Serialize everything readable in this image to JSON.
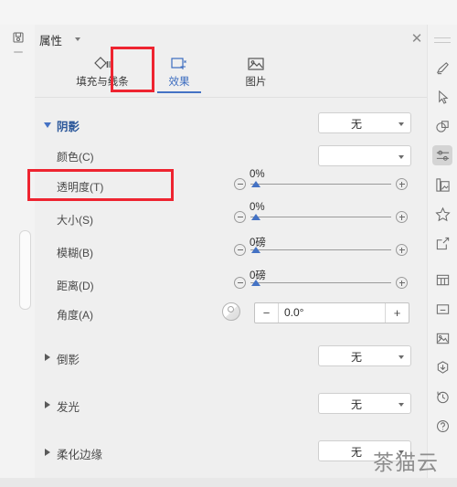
{
  "panel": {
    "title": "属性",
    "close_label": "✕",
    "pin_icon": "pin-icon"
  },
  "tabs": [
    {
      "label": "填充与线条",
      "icon": "fill-line-icon",
      "active": false
    },
    {
      "label": "效果",
      "icon": "effects-icon",
      "active": true
    },
    {
      "label": "图片",
      "icon": "picture-icon",
      "active": false
    }
  ],
  "sections": [
    {
      "name": "shadow",
      "label": "阴影",
      "expanded": true,
      "rows": [
        {
          "name": "preset",
          "label": "",
          "control": "dropdown",
          "value": "无"
        },
        {
          "name": "color",
          "label": "颜色(C)",
          "control": "dropdown",
          "value": ""
        },
        {
          "name": "transparency",
          "label": "透明度(T)",
          "control": "slider",
          "value": "0%"
        },
        {
          "name": "size",
          "label": "大小(S)",
          "control": "slider",
          "value": "0%"
        },
        {
          "name": "blur",
          "label": "模糊(B)",
          "control": "slider",
          "value": "0磅"
        },
        {
          "name": "distance",
          "label": "距离(D)",
          "control": "slider",
          "value": "0磅"
        },
        {
          "name": "angle",
          "label": "角度(A)",
          "control": "spinner",
          "value": "0.0°",
          "minus_label": "−",
          "plus_label": "+"
        }
      ]
    },
    {
      "name": "reflection",
      "label": "倒影",
      "expanded": false,
      "value": "无"
    },
    {
      "name": "glow",
      "label": "发光",
      "expanded": false,
      "value": "无"
    },
    {
      "name": "softedges",
      "label": "柔化边缘",
      "expanded": false,
      "value": "无"
    }
  ],
  "right_rail": [
    {
      "name": "pen-icon",
      "active": false
    },
    {
      "name": "cursor-icon",
      "active": false
    },
    {
      "name": "shapes-icon",
      "active": false
    },
    {
      "name": "settings-icon",
      "active": true
    },
    {
      "name": "gallery-icon",
      "active": false
    },
    {
      "name": "star-icon",
      "active": false
    },
    {
      "name": "share-icon",
      "active": false
    },
    {
      "name": "table-icon",
      "active": false
    },
    {
      "name": "box-icon",
      "active": false
    },
    {
      "name": "image-icon",
      "active": false
    },
    {
      "name": "download-icon",
      "active": false
    },
    {
      "name": "history-icon",
      "active": false
    },
    {
      "name": "help-icon",
      "active": false
    }
  ],
  "annotations": {
    "accent_color": "#ee2430",
    "boxes": [
      "effects-tab-highlight",
      "transparency-row-highlight"
    ]
  },
  "watermark": {
    "text": "茶猫云"
  }
}
